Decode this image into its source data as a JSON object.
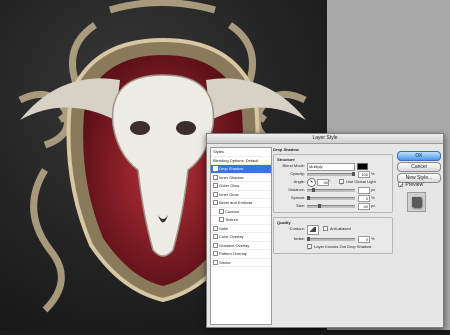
{
  "dialog": {
    "title": "Layer Style",
    "styles": [
      {
        "label": "Styles",
        "type": "header"
      },
      {
        "label": "Blending Options: Default",
        "type": "header"
      },
      {
        "label": "Drop Shadow",
        "checked": true,
        "selected": true
      },
      {
        "label": "Inner Shadow",
        "checked": false
      },
      {
        "label": "Outer Glow",
        "checked": false
      },
      {
        "label": "Inner Glow",
        "checked": false
      },
      {
        "label": "Bevel and Emboss",
        "checked": false
      },
      {
        "label": "Contour",
        "checked": false,
        "indent": true
      },
      {
        "label": "Texture",
        "checked": false,
        "indent": true
      },
      {
        "label": "Satin",
        "checked": false
      },
      {
        "label": "Color Overlay",
        "checked": false
      },
      {
        "label": "Gradient Overlay",
        "checked": false
      },
      {
        "label": "Pattern Overlay",
        "checked": false
      },
      {
        "label": "Stroke",
        "checked": false
      }
    ],
    "drop_shadow": {
      "title": "Drop Shadow",
      "structure": {
        "title": "Structure",
        "blend_mode_label": "Blend Mode:",
        "blend_mode_value": "Multiply",
        "swatch_color": "#000000",
        "opacity_label": "Opacity:",
        "opacity_value": "100",
        "opacity_unit": "%",
        "opacity_level": 1.0,
        "angle_label": "Angle:",
        "angle_value": "30",
        "angle_unit": "°",
        "use_global_light_label": "Use Global Light",
        "use_global_light": true,
        "distance_label": "Distance:",
        "distance_value": "",
        "distance_unit": "px",
        "distance_level": 0.1,
        "spread_label": "Spread:",
        "spread_value": "0",
        "spread_unit": "%",
        "spread_level": 0.0,
        "size_label": "Size:",
        "size_value": "40",
        "size_unit": "px",
        "size_level": 0.25
      },
      "quality": {
        "title": "Quality",
        "contour_label": "Contour:",
        "anti_aliased_label": "Anti-aliased",
        "noise_label": "Noise:",
        "noise_value": "0",
        "noise_unit": "%",
        "noise_level": 0.0,
        "knockout_label": "Layer Knocks Out Drop Shadow",
        "knockout": true
      }
    },
    "buttons": {
      "ok": "OK",
      "cancel": "Cancel",
      "new_style": "New Style..."
    },
    "preview_label": "Preview",
    "preview_checked": true
  },
  "colors": {
    "selection": "#3875d7",
    "ok_button": "#4d97e8"
  }
}
